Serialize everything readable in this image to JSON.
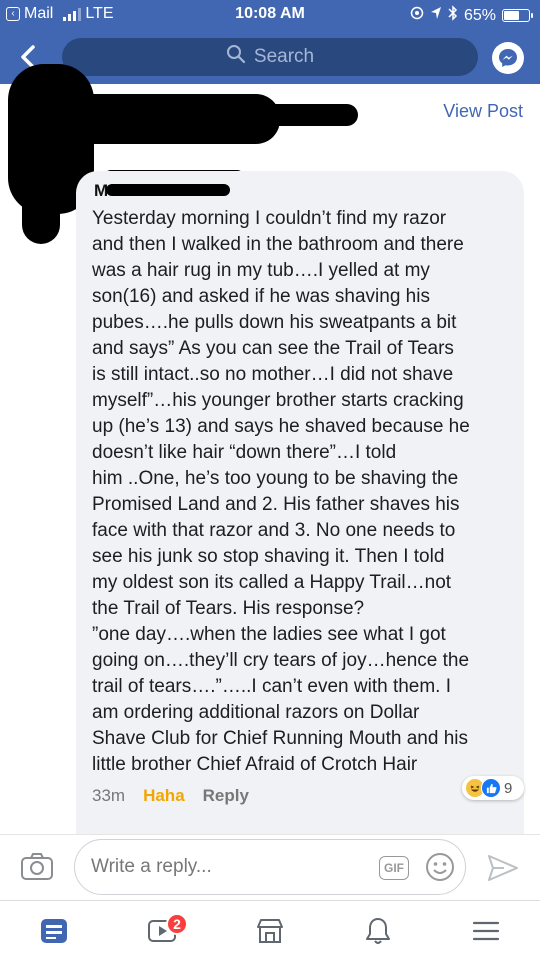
{
  "status_bar": {
    "back_app": "Mail",
    "carrier": "LTE",
    "time": "10:08 AM",
    "battery_percent": "65%",
    "battery_level": 0.65
  },
  "nav": {
    "search_placeholder": "Search"
  },
  "post": {
    "view_post_label": "View Post"
  },
  "comment": {
    "author_visible_initial": "M",
    "text": "Yesterday morning I couldn’t find my razor\nand then I walked in the bathroom and there\nwas a hair rug in my tub….I yelled at my\nson(16) and asked if he was shaving his\npubes….he pulls down his sweatpants a bit\nand says” As you can see the Trail of Tears\nis still intact..so no mother…I did not shave\nmyself”…his younger brother starts cracking\nup (he’s 13) and says he shaved because he\ndoesn’t like hair “down there”…I told\nhim ..One, he’s too young to be shaving the\nPromised Land and 2. His father shaves his\nface with that razor and 3. No one needs to\nsee his junk so stop shaving it. Then I told\nmy oldest son its called a Happy Trail…not\nthe Trail of Tears. His response?\n”one day….when the ladies see what I got\ngoing on….they’ll cry tears of joy…hence the\ntrail of tears….”…..I can’t even with them. I\nam ordering additional razors on Dollar\nShave Club for Chief Running Mouth and his\nlittle brother Chief Afraid of Crotch Hair",
    "time": "33m",
    "reaction_label": "Haha",
    "reply_label": "Reply",
    "reaction_count": "9",
    "reaction_icons": [
      "haha-icon",
      "like-icon"
    ],
    "haha_color": "#f2a700"
  },
  "composer": {
    "placeholder": "Write a reply...",
    "gif_label": "GIF"
  },
  "tabs": {
    "video_badge": "2",
    "items": [
      "news-feed-icon",
      "video-icon",
      "marketplace-icon",
      "notifications-icon",
      "menu-icon"
    ]
  },
  "colors": {
    "brand": "#4267b2",
    "search_bg": "#29487d",
    "bubble_bg": "#f0f2f5",
    "badge": "#fa3e3e"
  }
}
